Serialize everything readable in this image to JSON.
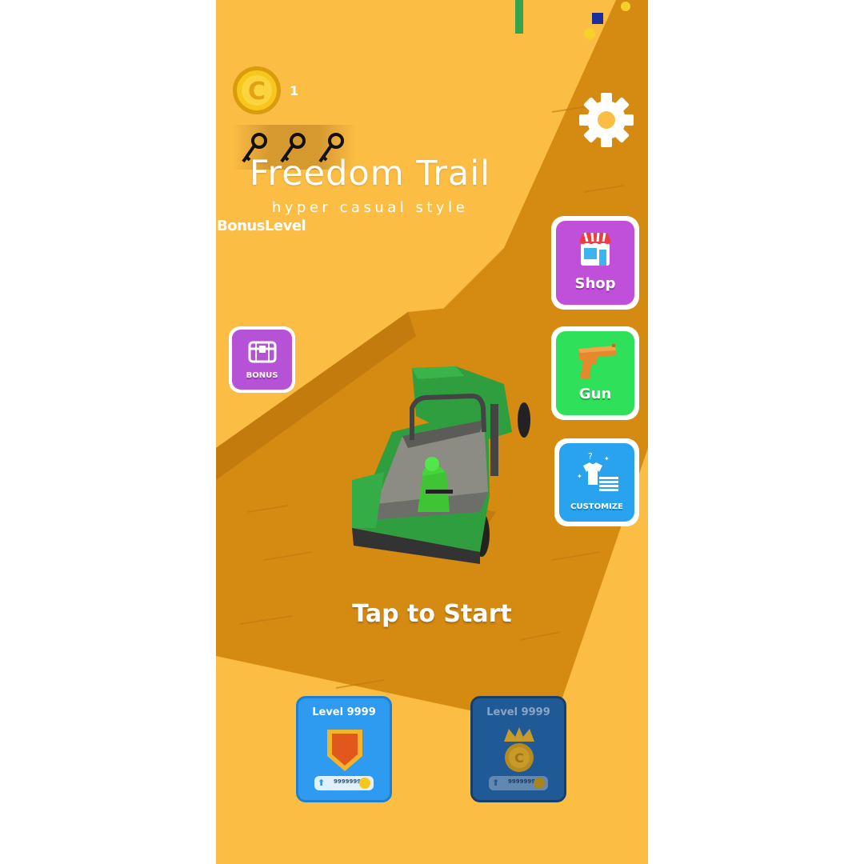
{
  "hud": {
    "coins": "1",
    "coin_letter": "C",
    "key_count_icons": 3
  },
  "title": {
    "main": "Freedom Trail",
    "subtitle": "hyper casual style",
    "bonus_level": "BonusLevel"
  },
  "buttons": {
    "bonus_label": "BONUS",
    "shop_label": "Shop",
    "gun_label": "Gun",
    "customize_label": "CUSTOMIZE"
  },
  "prompt": {
    "tap_to_start": "Tap to Start"
  },
  "level_cards": [
    {
      "title": "Level 9999",
      "value": "9999999",
      "state": "active"
    },
    {
      "title": "Level 9999",
      "value": "9999999",
      "state": "dimmed"
    }
  ],
  "colors": {
    "sand": "#fbbd43",
    "road": "#d58a12",
    "truck_green": "#2f9e3f",
    "soldier_green": "#43d63a",
    "shop_purple": "#c04fd9",
    "gun_green": "#2ee05a",
    "customize_blue": "#29a3ee",
    "bonus_purple": "#b552d6"
  }
}
